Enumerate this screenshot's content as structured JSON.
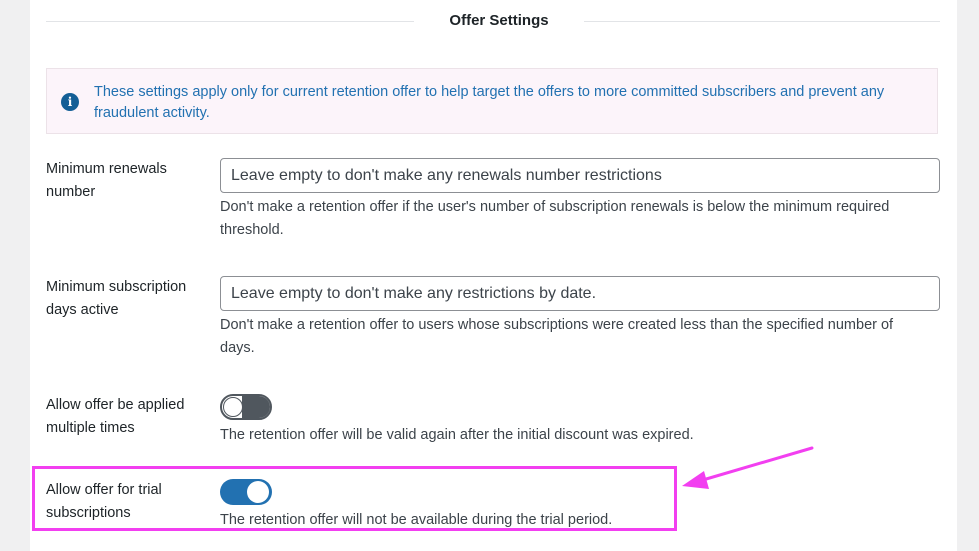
{
  "section": {
    "title": "Offer Settings"
  },
  "notice": {
    "icon": "info-icon",
    "text": "These settings apply only for current retention offer to help target the offers to more committed subscribers and prevent any fraudulent activity."
  },
  "fields": {
    "min_renewals": {
      "label": "Minimum renewals number",
      "placeholder": "Leave empty to don't make any renewals number restrictions",
      "value": "",
      "description": "Don't make a retention offer if the user's number of subscription renewals is below the minimum required threshold."
    },
    "min_days_active": {
      "label": "Minimum subscription days active",
      "placeholder": "Leave empty to don't make any restrictions by date.",
      "value": "",
      "description": "Don't make a retention offer to users whose subscriptions were created less than the specified number of days."
    },
    "allow_multiple": {
      "label": "Allow offer be applied multiple times",
      "enabled": false,
      "description": "The retention offer will be valid again after the initial discount was expired."
    },
    "allow_trial": {
      "label": "Allow offer for trial subscriptions",
      "enabled": true,
      "description": "The retention offer will not be available during the trial period."
    }
  },
  "annotation": {
    "color": "#f23ff0"
  },
  "colors": {
    "accent": "#2271b1",
    "toggle_off": "#50575e",
    "notice_bg": "#fcf4fa"
  }
}
